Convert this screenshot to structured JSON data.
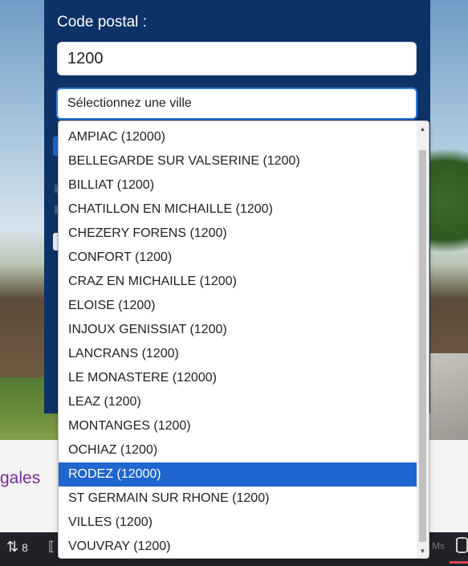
{
  "form": {
    "postal_label": "Code postal :",
    "postal_value": "1200",
    "city_select_placeholder": "Sélectionnez une ville"
  },
  "dropdown": {
    "options": [
      "AMPIAC (12000)",
      "BELLEGARDE SUR VALSERINE (1200)",
      "BILLIAT (1200)",
      "CHATILLON EN MICHAILLE (1200)",
      "CHEZERY FORENS (1200)",
      "CONFORT (1200)",
      "CRAZ EN MICHAILLE (1200)",
      "ELOISE (1200)",
      "INJOUX GENISSIAT (1200)",
      "LANCRANS (1200)",
      "LE MONASTERE (12000)",
      "LEAZ (1200)",
      "MONTANGES (1200)",
      "OCHIAZ (1200)",
      "RODEZ (12000)",
      "ST GERMAIN SUR RHONE (1200)",
      "VILLES (1200)",
      "VOUVRAY (1200)"
    ],
    "selected_option": "RODEZ (12000)",
    "selected_color": "#1f66d1",
    "scroll_up_icon": "triangle-up-icon",
    "scroll_down_icon": "triangle-down-icon"
  },
  "page": {
    "legal_link_partial": "gales"
  },
  "taskbar": {
    "sort_icon": "sort-arrows-icon",
    "sort_count": "8",
    "ms_label": "Ms",
    "db_icon": "database-icon"
  },
  "colors": {
    "panel_bg": "#0d3266",
    "focus_border": "#2f7de1"
  }
}
